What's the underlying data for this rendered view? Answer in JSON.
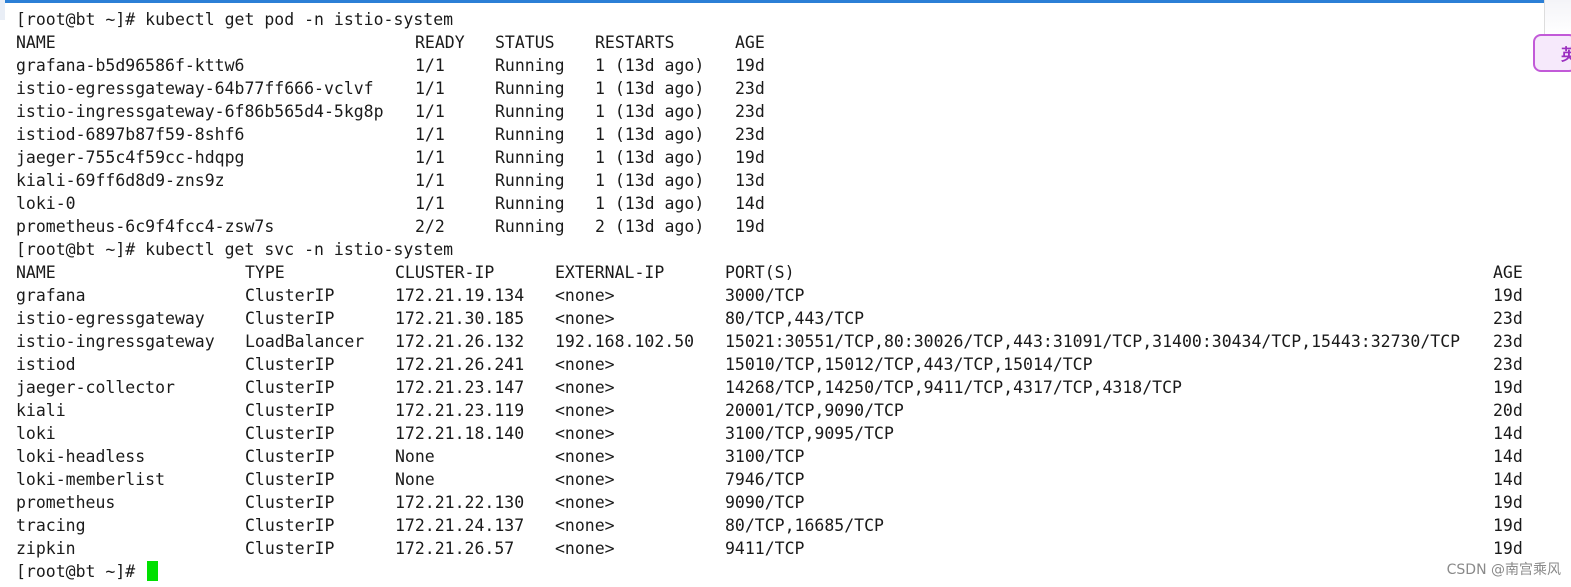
{
  "prompt1": "[root@bt ~]# kubectl get pod -n istio-system",
  "pods": {
    "headers": {
      "name": "NAME",
      "ready": "READY",
      "status": "STATUS",
      "restarts": "RESTARTS",
      "age": "AGE"
    },
    "rows": [
      {
        "name": "grafana-b5d96586f-kttw6",
        "ready": "1/1",
        "status": "Running",
        "restarts": "1 (13d ago)",
        "age": "19d"
      },
      {
        "name": "istio-egressgateway-64b77ff666-vclvf",
        "ready": "1/1",
        "status": "Running",
        "restarts": "1 (13d ago)",
        "age": "23d"
      },
      {
        "name": "istio-ingressgateway-6f86b565d4-5kg8p",
        "ready": "1/1",
        "status": "Running",
        "restarts": "1 (13d ago)",
        "age": "23d"
      },
      {
        "name": "istiod-6897b87f59-8shf6",
        "ready": "1/1",
        "status": "Running",
        "restarts": "1 (13d ago)",
        "age": "23d"
      },
      {
        "name": "jaeger-755c4f59cc-hdqpg",
        "ready": "1/1",
        "status": "Running",
        "restarts": "1 (13d ago)",
        "age": "19d"
      },
      {
        "name": "kiali-69ff6d8d9-zns9z",
        "ready": "1/1",
        "status": "Running",
        "restarts": "1 (13d ago)",
        "age": "13d"
      },
      {
        "name": "loki-0",
        "ready": "1/1",
        "status": "Running",
        "restarts": "1 (13d ago)",
        "age": "14d"
      },
      {
        "name": "prometheus-6c9f4fcc4-zsw7s",
        "ready": "2/2",
        "status": "Running",
        "restarts": "2 (13d ago)",
        "age": "19d"
      }
    ]
  },
  "prompt2": "[root@bt ~]# kubectl get svc -n istio-system",
  "svc": {
    "headers": {
      "name": "NAME",
      "type": "TYPE",
      "cip": "CLUSTER-IP",
      "eip": "EXTERNAL-IP",
      "ports": "PORT(S)",
      "age": "AGE"
    },
    "rows": [
      {
        "name": "grafana",
        "type": "ClusterIP",
        "cip": "172.21.19.134",
        "eip": "<none>",
        "ports": "3000/TCP",
        "age": "19d"
      },
      {
        "name": "istio-egressgateway",
        "type": "ClusterIP",
        "cip": "172.21.30.185",
        "eip": "<none>",
        "ports": "80/TCP,443/TCP",
        "age": "23d"
      },
      {
        "name": "istio-ingressgateway",
        "type": "LoadBalancer",
        "cip": "172.21.26.132",
        "eip": "192.168.102.50",
        "ports": "15021:30551/TCP,80:30026/TCP,443:31091/TCP,31400:30434/TCP,15443:32730/TCP",
        "age": "23d"
      },
      {
        "name": "istiod",
        "type": "ClusterIP",
        "cip": "172.21.26.241",
        "eip": "<none>",
        "ports": "15010/TCP,15012/TCP,443/TCP,15014/TCP",
        "age": "23d"
      },
      {
        "name": "jaeger-collector",
        "type": "ClusterIP",
        "cip": "172.21.23.147",
        "eip": "<none>",
        "ports": "14268/TCP,14250/TCP,9411/TCP,4317/TCP,4318/TCP",
        "age": "19d"
      },
      {
        "name": "kiali",
        "type": "ClusterIP",
        "cip": "172.21.23.119",
        "eip": "<none>",
        "ports": "20001/TCP,9090/TCP",
        "age": "20d"
      },
      {
        "name": "loki",
        "type": "ClusterIP",
        "cip": "172.21.18.140",
        "eip": "<none>",
        "ports": "3100/TCP,9095/TCP",
        "age": "14d"
      },
      {
        "name": "loki-headless",
        "type": "ClusterIP",
        "cip": "None",
        "eip": "<none>",
        "ports": "3100/TCP",
        "age": "14d"
      },
      {
        "name": "loki-memberlist",
        "type": "ClusterIP",
        "cip": "None",
        "eip": "<none>",
        "ports": "7946/TCP",
        "age": "14d"
      },
      {
        "name": "prometheus",
        "type": "ClusterIP",
        "cip": "172.21.22.130",
        "eip": "<none>",
        "ports": "9090/TCP",
        "age": "19d"
      },
      {
        "name": "tracing",
        "type": "ClusterIP",
        "cip": "172.21.24.137",
        "eip": "<none>",
        "ports": "80/TCP,16685/TCP",
        "age": "19d"
      },
      {
        "name": "zipkin",
        "type": "ClusterIP",
        "cip": "172.21.26.57",
        "eip": "<none>",
        "ports": "9411/TCP",
        "age": "19d"
      }
    ]
  },
  "prompt3": "[root@bt ~]# ",
  "ime_label": "英",
  "watermark": "CSDN @南宫乘风",
  "colors": {
    "cursor": "#00e000",
    "accent": "#2b7fd6",
    "ime": "#c25ad8"
  }
}
